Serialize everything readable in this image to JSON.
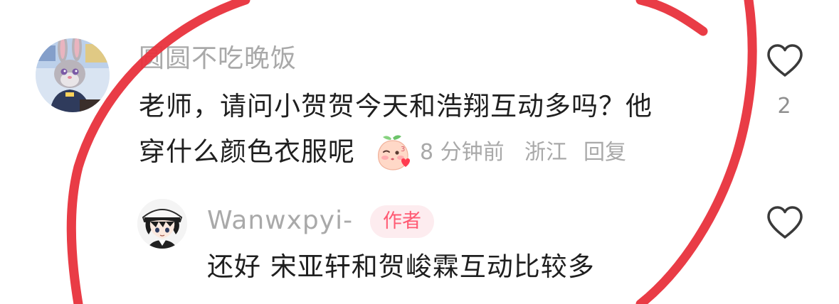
{
  "comment": {
    "username": "圆圆不吃晚饭",
    "text_line1": "老师，请问小贺贺今天和浩翔互动多吗？他",
    "text_line2": "穿什么颜色衣服呢",
    "time": "8 分钟前",
    "region": "浙江",
    "reply_label": "回复",
    "like_count": "2",
    "avatar_icon": "cartoon-rabbit-avatar",
    "emoji_icon": "shy-peach-emoji"
  },
  "reply": {
    "username": "Wanwxpyi-",
    "badge": "作者",
    "text": "还好 宋亚轩和贺峻霖互动比较多",
    "avatar_icon": "anime-boy-avatar"
  },
  "colors": {
    "annotation": "#e8323c",
    "username": "#a9a9a9",
    "text": "#1f1f1f",
    "badge_bg": "#fdecef",
    "badge_text": "#ff5a73"
  }
}
